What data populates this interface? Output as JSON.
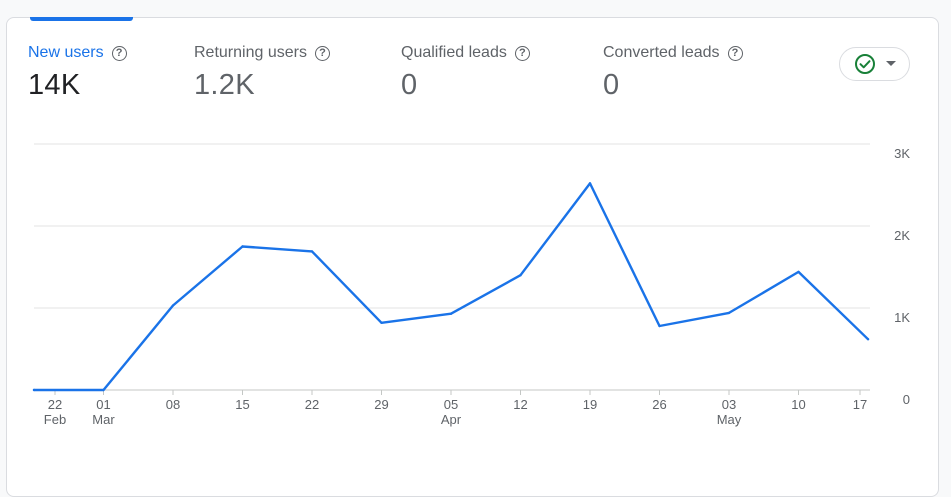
{
  "metrics": [
    {
      "label": "New users",
      "value": "14K",
      "active": true
    },
    {
      "label": "Returning users",
      "value": "1.2K",
      "active": false
    },
    {
      "label": "Qualified leads",
      "value": "0",
      "active": false
    },
    {
      "label": "Converted leads",
      "value": "0",
      "active": false
    }
  ],
  "help_glyph": "?",
  "colors": {
    "accent": "#1a73e8",
    "status_ok": "#188038",
    "line": "#1a73e8"
  },
  "chart_data": {
    "type": "line",
    "title": "",
    "xlabel": "",
    "ylabel": "",
    "x": [
      "22 Feb",
      "01 Mar",
      "08",
      "15",
      "22",
      "29",
      "05 Apr",
      "12",
      "19",
      "26",
      "03 May",
      "10",
      "17"
    ],
    "x_ticks": [
      {
        "day": "22",
        "month": "Feb"
      },
      {
        "day": "01",
        "month": "Mar"
      },
      {
        "day": "08",
        "month": ""
      },
      {
        "day": "15",
        "month": ""
      },
      {
        "day": "22",
        "month": ""
      },
      {
        "day": "29",
        "month": ""
      },
      {
        "day": "05",
        "month": "Apr"
      },
      {
        "day": "12",
        "month": ""
      },
      {
        "day": "19",
        "month": ""
      },
      {
        "day": "26",
        "month": ""
      },
      {
        "day": "03",
        "month": "May"
      },
      {
        "day": "10",
        "month": ""
      },
      {
        "day": "17",
        "month": ""
      }
    ],
    "series": [
      {
        "values": [
          0,
          0,
          1030,
          1750,
          1690,
          820,
          930,
          1400,
          2520,
          780,
          940,
          1440,
          620
        ]
      }
    ],
    "y_ticks": [
      0,
      1000,
      2000,
      3000
    ],
    "y_tick_labels": [
      "0",
      "1K",
      "2K",
      "3K"
    ],
    "ylim": [
      0,
      3000
    ],
    "grid": true,
    "y_axis_position": "right"
  }
}
